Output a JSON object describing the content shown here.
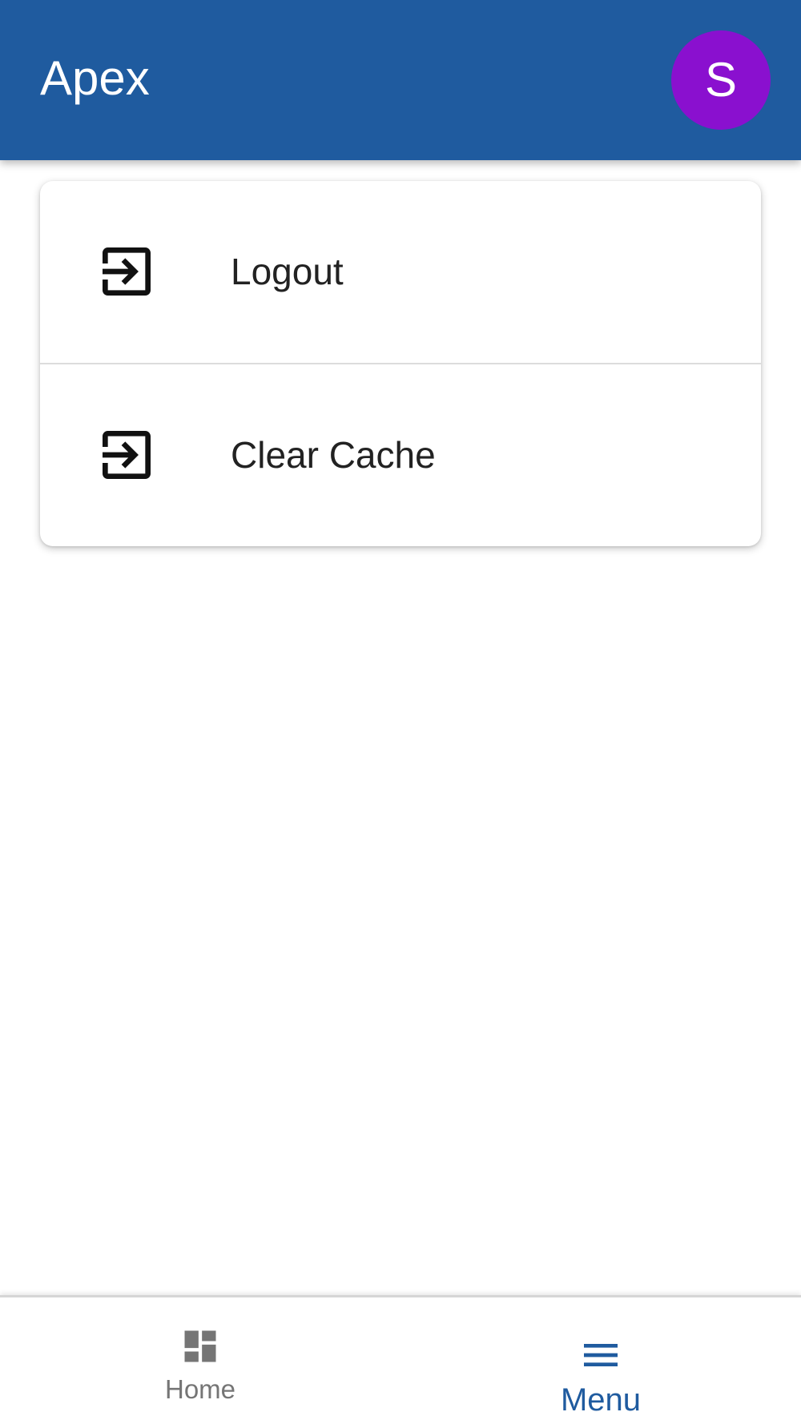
{
  "app": {
    "title": "Apex",
    "avatar_initial": "S",
    "colors": {
      "appbar": "#1f5b9f",
      "avatar": "#8a10cf",
      "active_nav": "#1f5b9f",
      "inactive_nav": "#757575"
    }
  },
  "menu": {
    "items": [
      {
        "label": "Logout",
        "icon": "exit-to-app-icon"
      },
      {
        "label": "Clear Cache",
        "icon": "exit-to-app-icon"
      }
    ]
  },
  "bottom_nav": {
    "items": [
      {
        "label": "Home",
        "icon": "dashboard-icon",
        "active": false
      },
      {
        "label": "Menu",
        "icon": "hamburger-menu-icon",
        "active": true
      }
    ]
  }
}
